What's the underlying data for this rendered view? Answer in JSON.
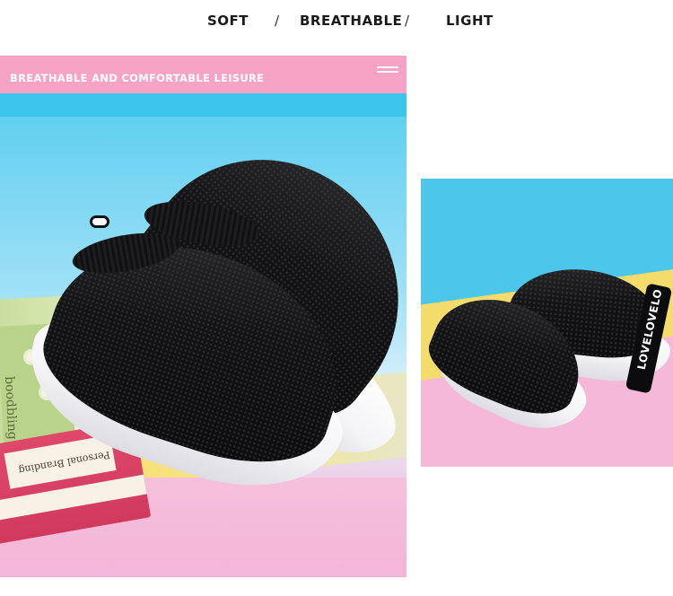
{
  "features": {
    "soft": "SOFT",
    "separator1": "/",
    "breathable": "BREATHABLE",
    "separator2": "/",
    "light": "LIGHT"
  },
  "left_photo": {
    "caption": "BREATHABLE AND COMFORTABLE LEISURE",
    "icon": "menu-lines-icon",
    "book_title": "boodbling",
    "book_label": "Personal Branding"
  },
  "right_photo": {
    "heel_text": "LOVELOVELO"
  },
  "colors": {
    "pink": "#f7a3c6",
    "blue": "#3cc4ea",
    "yellow": "#f4dc6c",
    "black": "#0c0c0e"
  }
}
